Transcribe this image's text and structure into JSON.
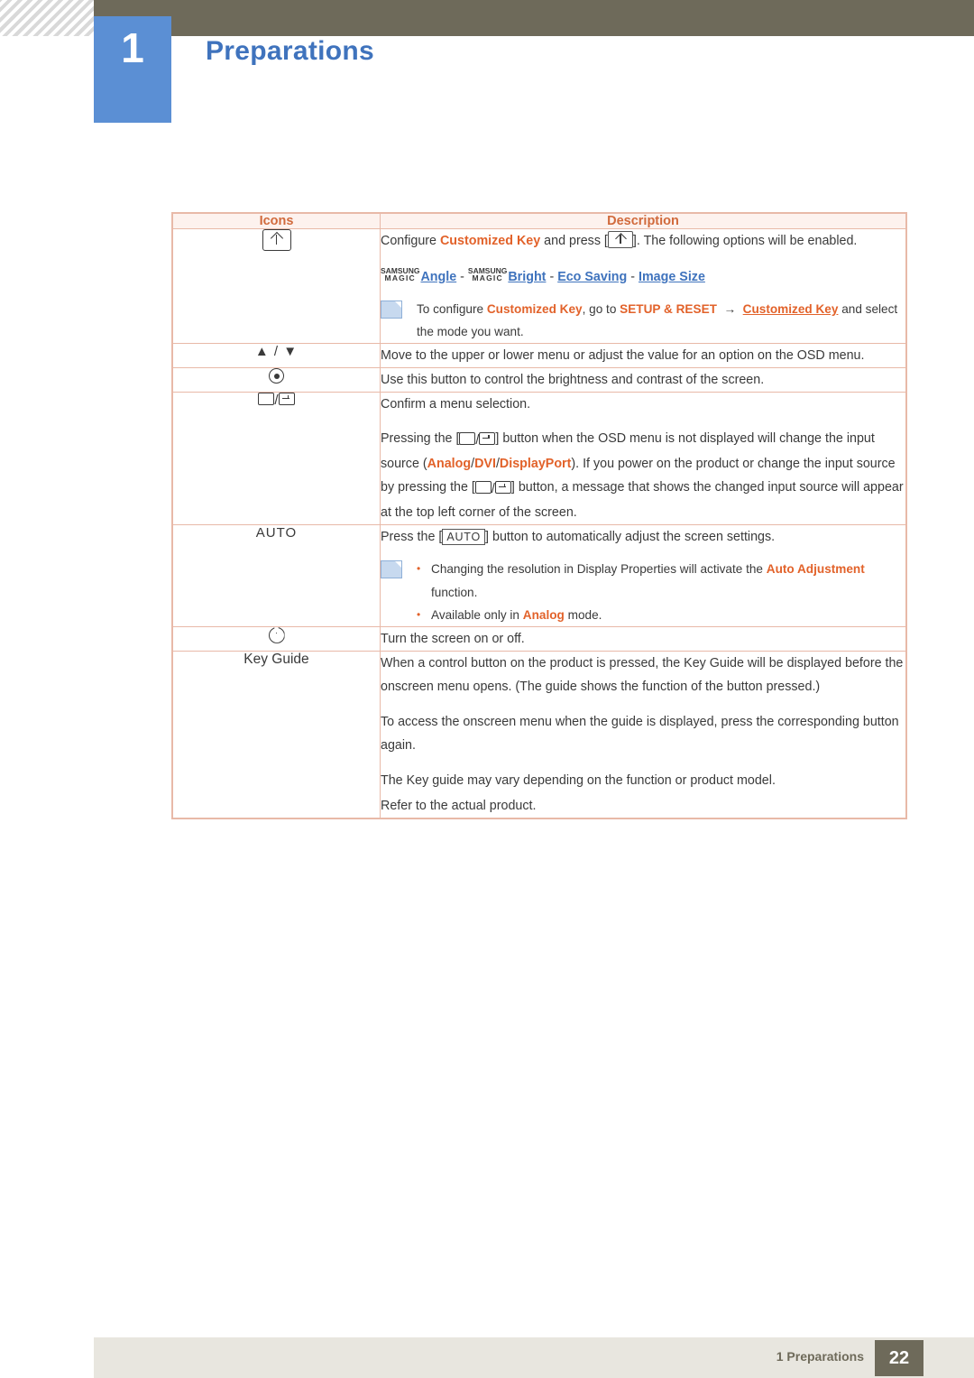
{
  "header": {
    "chapter_number": "1",
    "chapter_title": "Preparations"
  },
  "table": {
    "headers": {
      "icons": "Icons",
      "description": "Description"
    },
    "rows": [
      {
        "icon_name": "customized-key-icon",
        "icon_label": "",
        "desc": {
          "line1_a": "Configure ",
          "line1_b": "Customized Key",
          "line1_c": " and press [",
          "line1_d": "]. The following options will be enabled.",
          "magic1": "SAMSUNG",
          "magic2": "MAGIC",
          "opt_angle": "Angle",
          "opt_bright": "Bright",
          "opt_eco": "Eco Saving",
          "opt_image_size": "Image Size",
          "sep": "-",
          "note_a": "To configure ",
          "note_b": "Customized Key",
          "note_c": ", go to ",
          "note_d": "SETUP & RESET",
          "note_arrow": "→",
          "note_e": "Customized Key",
          "note_f": " and select the mode you want."
        }
      },
      {
        "icon_name": "up-down-arrows-icon",
        "icon_label": "▲ / ▼",
        "desc": {
          "text": "Move to the upper or lower menu or adjust the value for an option on the OSD menu."
        }
      },
      {
        "icon_name": "brightness-contrast-icon",
        "icon_label": "",
        "desc": {
          "text": "Use this button to control the brightness and contrast of the screen."
        }
      },
      {
        "icon_name": "enter-source-icon",
        "icon_label": "",
        "desc": {
          "p1": "Confirm a menu selection.",
          "p2_a": "Pressing the [",
          "p2_b": "] button when the OSD menu is not displayed will change the input source (",
          "src_analog": "Analog",
          "src_dvi": "DVI",
          "src_dp": "DisplayPort",
          "p2_c": "). If you power on the product or change the input source by pressing the [",
          "p2_d": "] button, a message that shows the changed input source will appear at the top left corner of the screen."
        }
      },
      {
        "icon_name": "auto-button-icon",
        "icon_label": "AUTO",
        "desc": {
          "p1_a": "Press the [",
          "p1_key": "AUTO",
          "p1_b": "] button to automatically adjust the screen settings.",
          "b1_a": "Changing the resolution in Display Properties will activate the ",
          "b1_b": "Auto Adjustment",
          "b1_c": " function.",
          "b2_a": "Available only in ",
          "b2_b": "Analog",
          "b2_c": " mode."
        }
      },
      {
        "icon_name": "power-button-icon",
        "icon_label": "",
        "desc": {
          "text": "Turn the screen on or off."
        }
      },
      {
        "icon_name": "key-guide-label",
        "icon_label": "Key Guide",
        "desc": {
          "p1": "When a control button on the product is pressed, the Key Guide will be displayed before the onscreen menu opens. (The guide shows the function of the button pressed.)",
          "p2": "To access the onscreen menu when the guide is displayed, press the corresponding button again.",
          "p3": "The Key guide may vary depending on the function or product model.",
          "p4": "Refer to the actual product."
        }
      }
    ]
  },
  "footer": {
    "label": "1 Preparations",
    "page": "22"
  },
  "colors": {
    "accent_orange": "#e2622a",
    "accent_blue": "#3f73bd",
    "header_brown": "#6e6a5a",
    "table_border": "#e8b9a8",
    "table_head_bg": "#fdf2ee"
  }
}
